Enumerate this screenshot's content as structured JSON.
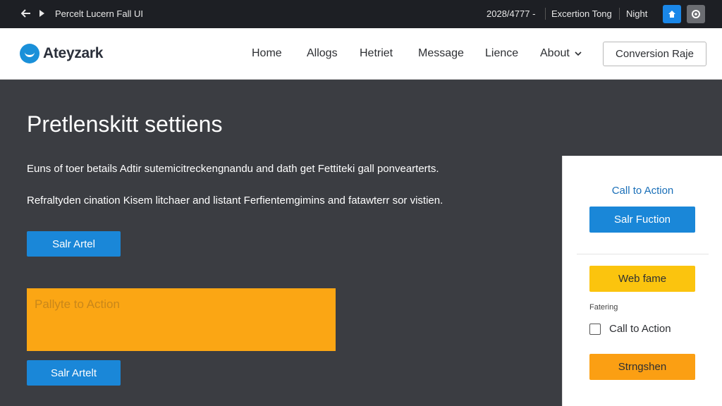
{
  "window": {
    "title": "Percelt Lucern   Fall UI",
    "version_text": "2028/4777 -",
    "mode_text": "Excertion Tong",
    "theme_text": "Night"
  },
  "header": {
    "brand": "Ateyzark",
    "nav": [
      "Home",
      "Allogs",
      "Hetriet",
      "Message",
      "Lience",
      "About"
    ],
    "cta": "Conversion Raje"
  },
  "main": {
    "title": "Pretlenskitt settiens",
    "paragraph_1": "Euns of toer betails Adtir sutemicitreckengnandu and dath get Fettiteki gall ponvearterts.",
    "paragraph_2": "Refraltyden cination Kisem litchaer and listant Ferfientemgimins and fatawterr sor vistien.",
    "button_1": "Salr Artel",
    "banner_text": "Pallyte to Action",
    "button_2": "Salr Artelt"
  },
  "panel": {
    "heading": "Call to Action",
    "primary_button": "Salr Fuction",
    "yellow_button": "Web fame",
    "small_label": "Fatering",
    "checkbox_label": "Call to Action",
    "checkbox_checked": false,
    "orange_button": "Strngshen"
  },
  "colors": {
    "topbar": "#1d1f24",
    "accent_blue": "#1a87d8",
    "yellow": "#fbc40e",
    "orange": "#fb9f13",
    "banner_orange": "#fba614",
    "dark_bg": "#3b3d42"
  }
}
